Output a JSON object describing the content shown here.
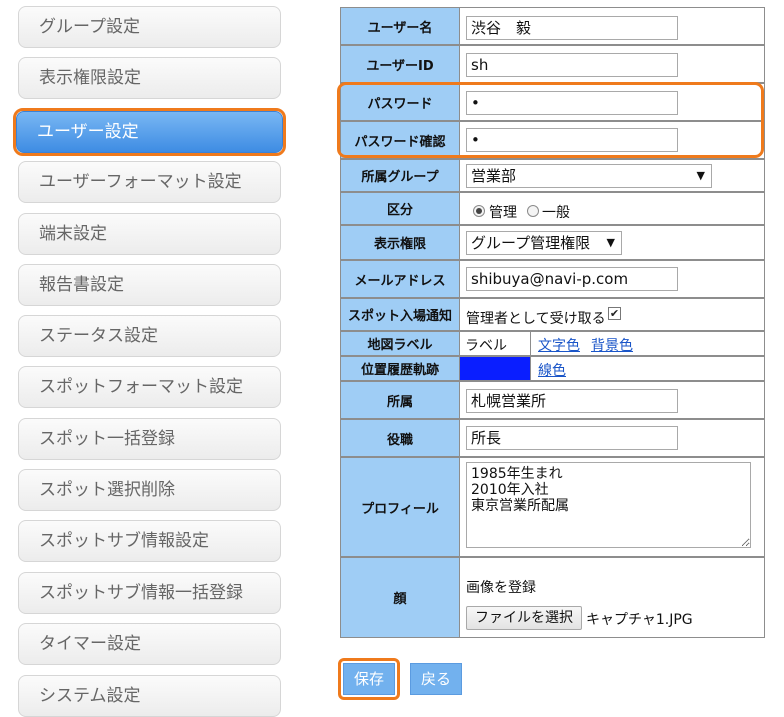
{
  "sidebar": {
    "items": [
      {
        "label": "グループ設定"
      },
      {
        "label": "表示権限設定"
      },
      {
        "label": "ユーザー設定",
        "active": true
      },
      {
        "label": "ユーザーフォーマット設定"
      },
      {
        "label": "端末設定"
      },
      {
        "label": "報告書設定"
      },
      {
        "label": "ステータス設定"
      },
      {
        "label": "スポットフォーマット設定"
      },
      {
        "label": "スポット一括登録"
      },
      {
        "label": "スポット選択削除"
      },
      {
        "label": "スポットサブ情報設定"
      },
      {
        "label": "スポットサブ情報一括登録"
      },
      {
        "label": "タイマー設定"
      },
      {
        "label": "システム設定"
      }
    ]
  },
  "form": {
    "user_name": {
      "label": "ユーザー名",
      "value": "渋谷　毅"
    },
    "user_id": {
      "label": "ユーザーID",
      "value": "sh"
    },
    "password": {
      "label": "パスワード",
      "value": "•"
    },
    "password_confirm": {
      "label": "パスワード確認",
      "value": "•"
    },
    "group": {
      "label": "所属グループ",
      "value": "営業部"
    },
    "category": {
      "label": "区分",
      "options": [
        "管理",
        "一般"
      ],
      "selected": "管理"
    },
    "display_permission": {
      "label": "表示権限",
      "value": "グループ管理権限"
    },
    "email": {
      "label": "メールアドレス",
      "value": "shibuya@navi-p.com"
    },
    "spot_notify": {
      "label": "スポット入場通知",
      "text": "管理者として受け取る",
      "checked": true
    },
    "map_label": {
      "label": "地図ラベル",
      "text": "ラベル",
      "text_color_link": "文字色",
      "bg_color_link": "背景色"
    },
    "track": {
      "label": "位置履歴軌跡",
      "color": "#0a1eff",
      "line_color_link": "線色"
    },
    "office": {
      "label": "所属",
      "value": "札幌営業所"
    },
    "position": {
      "label": "役職",
      "value": "所長"
    },
    "profile": {
      "label": "プロフィール",
      "value": "1985年生まれ\n2010年入社\n東京営業所配属"
    },
    "face": {
      "label": "顔",
      "register_text": "画像を登録",
      "file_button": "ファイルを選択",
      "file_name": "キャプチャ1.JPG"
    }
  },
  "buttons": {
    "save": "保存",
    "back": "戻る"
  },
  "colors": {
    "label_bg": "#9fcdf5",
    "active_nav": "#4a94e6",
    "highlight": "#ef7a1c",
    "link": "#1a55c8"
  }
}
